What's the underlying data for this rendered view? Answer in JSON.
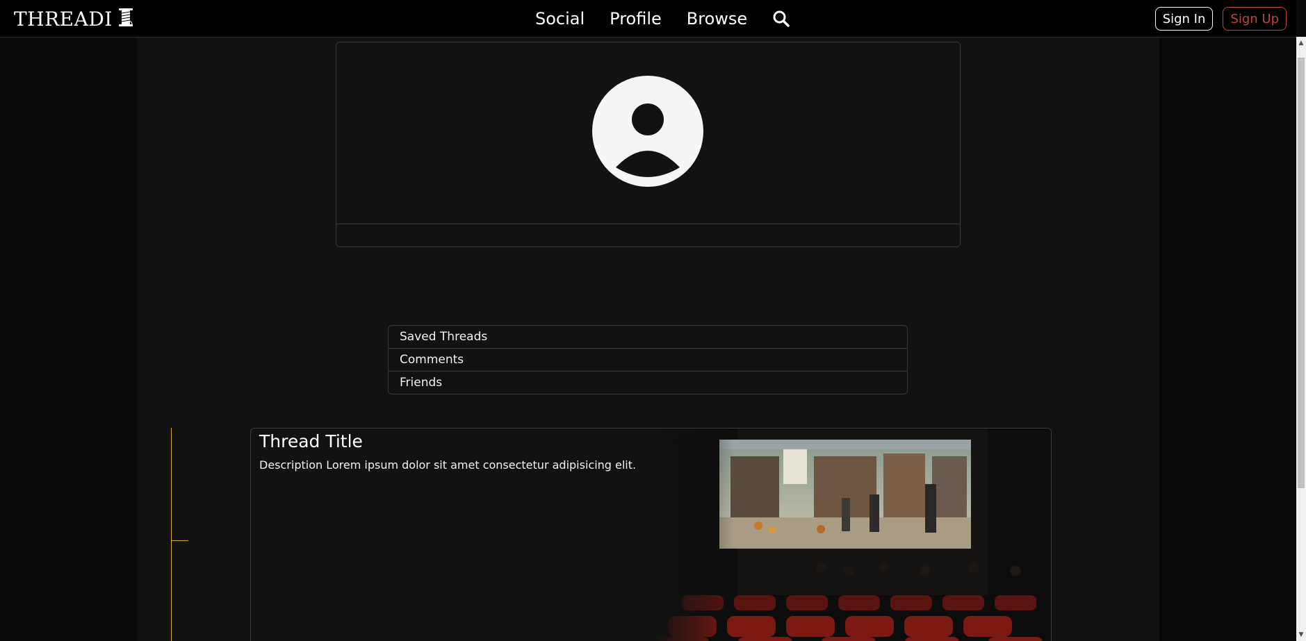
{
  "app": {
    "logo_text": "THREADI",
    "logo_icon": "spool-of-thread-icon"
  },
  "nav": {
    "links": [
      "Social",
      "Profile",
      "Browse"
    ],
    "search_icon": "search-icon"
  },
  "auth": {
    "sign_in": "Sign In",
    "sign_up": "Sign Up"
  },
  "profile": {
    "avatar_icon": "user-avatar-icon"
  },
  "tabs": [
    "Saved Threads",
    "Comments",
    "Friends"
  ],
  "thread": {
    "title": "Thread Title",
    "description": "Description Lorem ipsum dolor sit amet consectetur adipisicing elit.",
    "image": "movie-theater-screen-image"
  },
  "colors": {
    "background": "#0a0a0a",
    "panel": "#121212",
    "border": "#3a3a3a",
    "sign_up_red": "#c0443f",
    "thread_line_gold": "#d8a93a"
  }
}
